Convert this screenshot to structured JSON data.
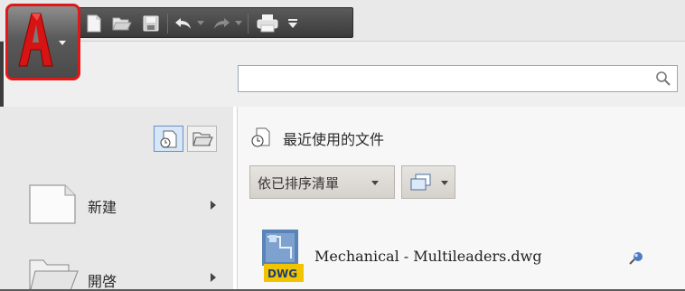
{
  "app_menu": {
    "app_button_icon": "autocad-a-logo-icon",
    "search": {
      "placeholder": "",
      "value": ""
    },
    "quick_access_toolbar": [
      {
        "name": "new-icon"
      },
      {
        "name": "open-icon"
      },
      {
        "name": "save-icon"
      },
      {
        "name": "undo-icon"
      },
      {
        "name": "redo-icon"
      },
      {
        "name": "plot-icon"
      },
      {
        "name": "customize-dropdown-icon"
      }
    ],
    "commands": [
      {
        "label": "新建",
        "icon": "new-document-icon",
        "has_submenu": true
      },
      {
        "label": "開啓",
        "icon": "open-folder-icon",
        "has_submenu": true
      }
    ],
    "view_toggles": [
      {
        "name": "recent-documents-icon",
        "active": true
      },
      {
        "name": "open-documents-icon",
        "active": false
      }
    ],
    "recent_panel": {
      "title": "最近使用的文件",
      "sort_dropdown": "依已排序清單",
      "view_dropdown_icon": "icon-view-icon",
      "files": [
        {
          "name": "Mechanical - Multileaders.dwg",
          "type_badge": "DWG",
          "pin_icon": "pushpin-icon"
        }
      ]
    }
  },
  "colors": {
    "accent_red": "#e01818",
    "toolbar_dark": "#3a3a3a",
    "highlight_blue": "#d6e7fa"
  }
}
